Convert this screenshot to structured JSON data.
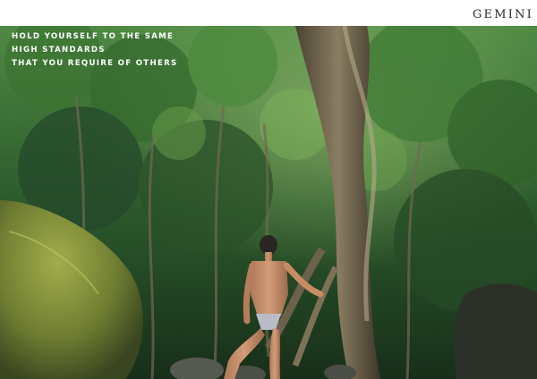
{
  "brand": {
    "name": "GEMINI"
  },
  "quote": {
    "lines": [
      "HOLD YOURSELF TO THE SAME",
      "HIGH STANDARDS",
      "THAT YOU REQUIRE OF OTHERS"
    ]
  },
  "colors": {
    "page_background": "#ffffff",
    "quote_text": "#ffffff",
    "brand_text": "#2a2a2a",
    "forest_dark": "#1d3a22",
    "foliage": "#3f7a34",
    "moss": "#8a9a3a"
  }
}
